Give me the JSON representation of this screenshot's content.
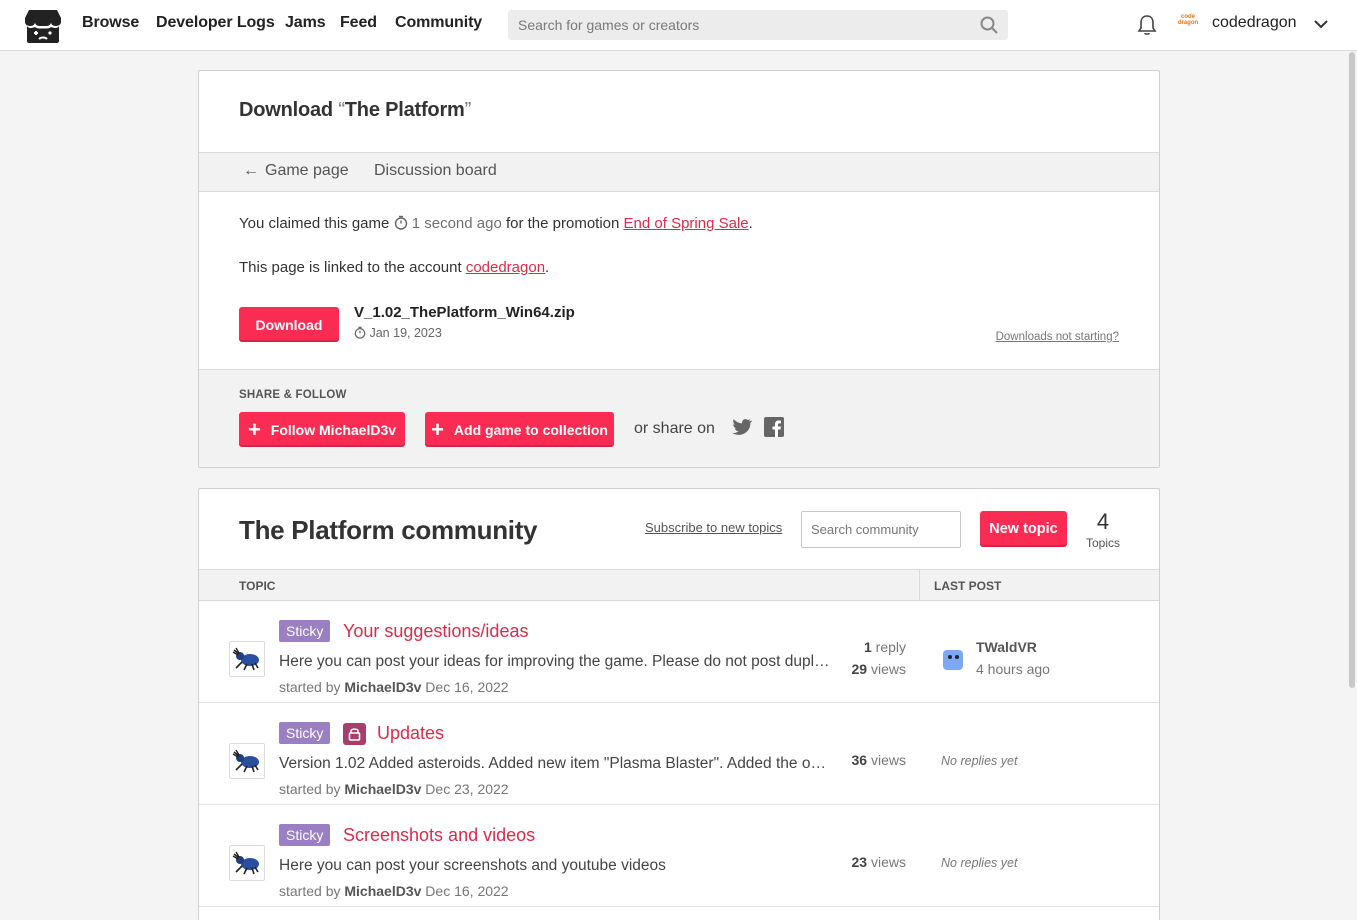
{
  "header": {
    "nav": [
      "Browse",
      "Developer Logs",
      "Jams",
      "Feed",
      "Community"
    ],
    "search_placeholder": "Search for games or creators",
    "avatar_text": "code dragon",
    "username": "codedragon"
  },
  "download": {
    "title_prefix": "Download ",
    "title_open_quote": "“",
    "game_name": "The Platform",
    "title_close_quote": "”",
    "tabs": {
      "back_arrow": "←",
      "game_page": "Game page",
      "discussion": "Discussion board"
    },
    "claimed_prefix": "You claimed this game ",
    "claimed_time": "1 second ago",
    "claimed_mid": " for the promotion ",
    "promotion": "End of Spring Sale",
    "claimed_end": ".",
    "linked_prefix": "This page is linked to the account ",
    "account": "codedragon",
    "linked_end": ".",
    "download_button": "Download",
    "file_name": "V_1.02_ThePlatform_Win64.zip",
    "file_date": "Jan 19, 2023",
    "help_link": "Downloads not starting?"
  },
  "share": {
    "label": "SHARE & FOLLOW",
    "follow_button": "Follow MichaelD3v",
    "collection_button": "Add game to collection",
    "share_on": "or share on"
  },
  "community": {
    "title": "The Platform community",
    "subscribe": "Subscribe to new topics",
    "search_placeholder": "Search community",
    "new_topic": "New topic",
    "topic_count": "4",
    "topic_count_label": "Topics",
    "col_topic": "TOPIC",
    "col_last_post": "LAST POST",
    "topics": [
      {
        "badge": "Sticky",
        "title": "Your suggestions/ideas",
        "excerpt": "Here you can post your ideas for improving the game. Please do not post duplicates",
        "started_prefix": "started by ",
        "author": "MichaelD3v",
        "date": " Dec 16, 2022",
        "replies_num": "1",
        "replies_lbl": " reply",
        "views_num": "29",
        "views_lbl": " views",
        "last_user": "TWaldVR",
        "last_time": "4 hours ago"
      },
      {
        "badge": "Sticky",
        "title": "Updates",
        "excerpt": "Version 1.02 Added asteroids. Added new item \"Plasma Blaster\". Added the option",
        "started_prefix": "started by ",
        "author": "MichaelD3v",
        "date": " Dec 23, 2022",
        "views_num": "36",
        "views_lbl": " views",
        "no_replies": "No replies yet"
      },
      {
        "badge": "Sticky",
        "title": "Screenshots and videos",
        "excerpt": "Here you can post your screenshots and youtube videos",
        "started_prefix": "started by ",
        "author": "MichaelD3v",
        "date": " Dec 16, 2022",
        "views_num": "23",
        "views_lbl": " views",
        "no_replies": "No replies yet"
      }
    ]
  },
  "colors": {
    "accent": "#fa2c53",
    "link": "#da2c49",
    "sticky": "#9a7fc3",
    "lock": "#a73f6e"
  }
}
